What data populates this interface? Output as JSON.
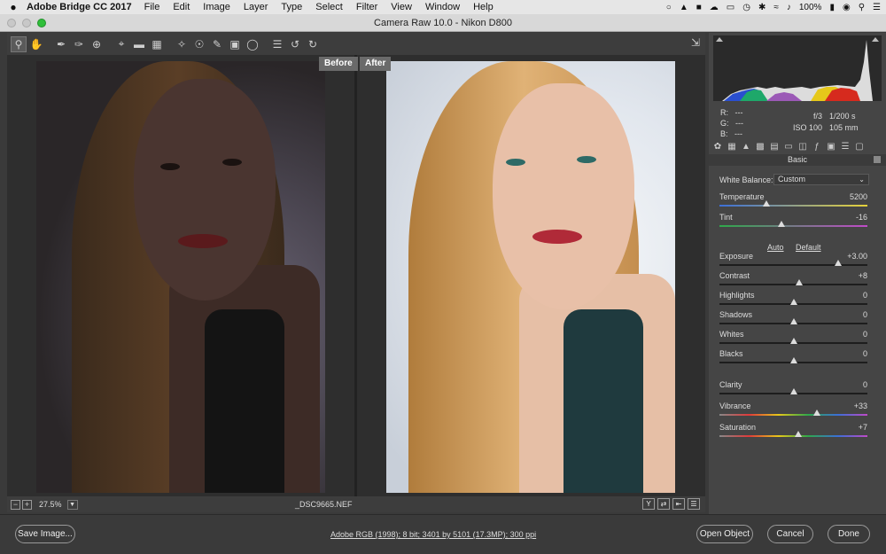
{
  "menubar": {
    "apple": "",
    "app_name": "Adobe Bridge CC 2017",
    "items": [
      "File",
      "Edit",
      "Image",
      "Layer",
      "Type",
      "Select",
      "Filter",
      "View",
      "Window",
      "Help"
    ],
    "battery": "100%"
  },
  "window": {
    "title": "Camera Raw 10.0  -  Nikon D800"
  },
  "preview": {
    "before_label": "Before",
    "after_label": "After",
    "zoom": "27.5%",
    "filename": "_DSC9665.NEF"
  },
  "info": {
    "r_label": "R:",
    "g_label": "G:",
    "b_label": "B:",
    "r_val": "---",
    "g_val": "---",
    "b_val": "---",
    "aperture": "f/3",
    "shutter": "1/200 s",
    "iso": "ISO 100",
    "focal": "105 mm"
  },
  "panel": {
    "section_title": "Basic",
    "white_balance_label": "White Balance:",
    "white_balance_value": "Custom",
    "auto_label": "Auto",
    "default_label": "Default",
    "sliders": [
      {
        "name": "Temperature",
        "value": "5200",
        "pos": 0.32
      },
      {
        "name": "Tint",
        "value": "-16",
        "pos": 0.42
      },
      {
        "name": "Exposure",
        "value": "+3.00",
        "pos": 0.8
      },
      {
        "name": "Contrast",
        "value": "+8",
        "pos": 0.54
      },
      {
        "name": "Highlights",
        "value": "0",
        "pos": 0.5
      },
      {
        "name": "Shadows",
        "value": "0",
        "pos": 0.5
      },
      {
        "name": "Whites",
        "value": "0",
        "pos": 0.5
      },
      {
        "name": "Blacks",
        "value": "0",
        "pos": 0.5
      },
      {
        "name": "Clarity",
        "value": "0",
        "pos": 0.5
      },
      {
        "name": "Vibrance",
        "value": "+33",
        "pos": 0.66
      },
      {
        "name": "Saturation",
        "value": "+7",
        "pos": 0.53
      }
    ]
  },
  "bottom": {
    "save_image": "Save Image...",
    "workflow_link": "Adobe RGB (1998); 8 bit; 3401 by 5101 (17.3MP); 300 ppi",
    "open_object": "Open Object",
    "cancel": "Cancel",
    "done": "Done"
  }
}
